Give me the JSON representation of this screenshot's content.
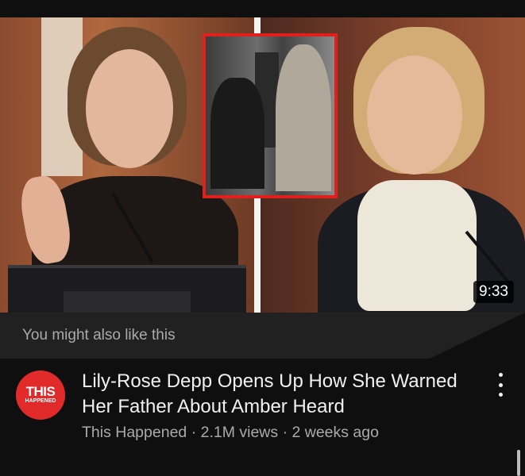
{
  "video": {
    "duration": "9:33",
    "title": "Lily-Rose Depp Opens Up How She Warned Her Father About Amber Heard",
    "channel": "This Happened",
    "views": "2.1M views",
    "age": "2 weeks ago",
    "separator": "·"
  },
  "suggestion": {
    "label": "You might also like this"
  },
  "channel_avatar": {
    "line1": "THIS",
    "line2": "HAPPENED",
    "color": "#e12a2a"
  },
  "icons": {
    "menu": "more-vertical-icon"
  }
}
